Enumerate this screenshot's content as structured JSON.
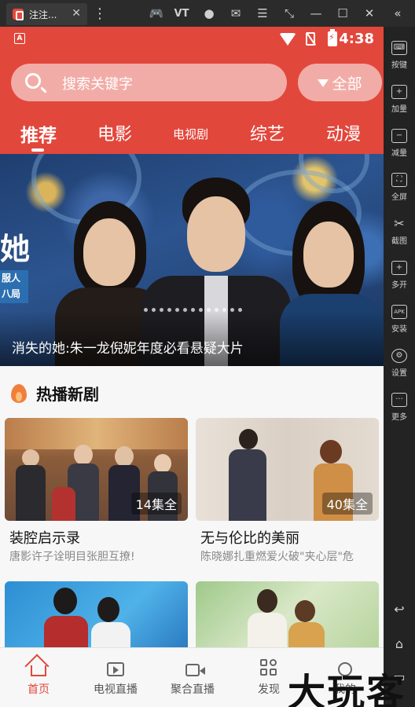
{
  "emulator": {
    "tab_title": "注注...",
    "tab_close": "✕",
    "toolbar_icons": [
      "gamepad-icon",
      "vt-label",
      "user-icon",
      "mail-icon",
      "menu-icon",
      "resize-icon",
      "minimize-icon",
      "maximize-icon",
      "close-icon",
      "collapse-icon"
    ],
    "vt_label": "VT",
    "sidebar": [
      {
        "label": "按键",
        "icon": "keyboard-icon"
      },
      {
        "label": "加量",
        "icon": "volume-up-icon"
      },
      {
        "label": "减量",
        "icon": "volume-down-icon"
      },
      {
        "label": "全屏",
        "icon": "fullscreen-icon"
      },
      {
        "label": "截图",
        "icon": "scissors-icon"
      },
      {
        "label": "多开",
        "icon": "multi-instance-icon"
      },
      {
        "label": "安装",
        "icon": "apk-icon"
      },
      {
        "label": "设置",
        "icon": "gear-icon"
      },
      {
        "label": "更多",
        "icon": "more-icon"
      }
    ],
    "nav_back_icon": "back-icon",
    "nav_home_icon": "home-icon"
  },
  "status_bar": {
    "time": "4:38",
    "left_badge": "A"
  },
  "header": {
    "search_placeholder": "搜索关键字",
    "filter_label": "全部",
    "tabs": [
      {
        "label": "推荐",
        "active": true
      },
      {
        "label": "电影",
        "active": false
      },
      {
        "label": "电视剧",
        "active": false
      },
      {
        "label": "综艺",
        "active": false
      },
      {
        "label": "动漫",
        "active": false
      }
    ]
  },
  "banner": {
    "caption": "消失的她:朱一龙倪妮年度必看悬疑大片",
    "poster_text": "她",
    "poster_badge": "服人 八局",
    "dot_count": 13
  },
  "section": {
    "title": "热播新剧",
    "icon": "flame-icon"
  },
  "cards": [
    {
      "title": "装腔启示录",
      "subtitle": "唐影许子诠明目张胆互撩!",
      "episodes": "14集全"
    },
    {
      "title": "无与伦比的美丽",
      "subtitle": "陈晓娜扎重燃爱火破\"夹心层\"危",
      "episodes": "40集全"
    },
    {
      "title": "",
      "subtitle": "",
      "episodes": ""
    },
    {
      "title": "",
      "subtitle": "",
      "episodes": ""
    }
  ],
  "bottom_nav": [
    {
      "label": "首页",
      "icon": "home-icon",
      "active": true
    },
    {
      "label": "电视直播",
      "icon": "tv-icon",
      "active": false
    },
    {
      "label": "聚合直播",
      "icon": "camera-icon",
      "active": false
    },
    {
      "label": "发现",
      "icon": "grid-icon",
      "active": false
    },
    {
      "label": "我的",
      "icon": "user-icon",
      "active": false
    }
  ],
  "watermark": "大玩客",
  "colors": {
    "accent": "#e2473c",
    "nav_active": "#e2473c"
  }
}
